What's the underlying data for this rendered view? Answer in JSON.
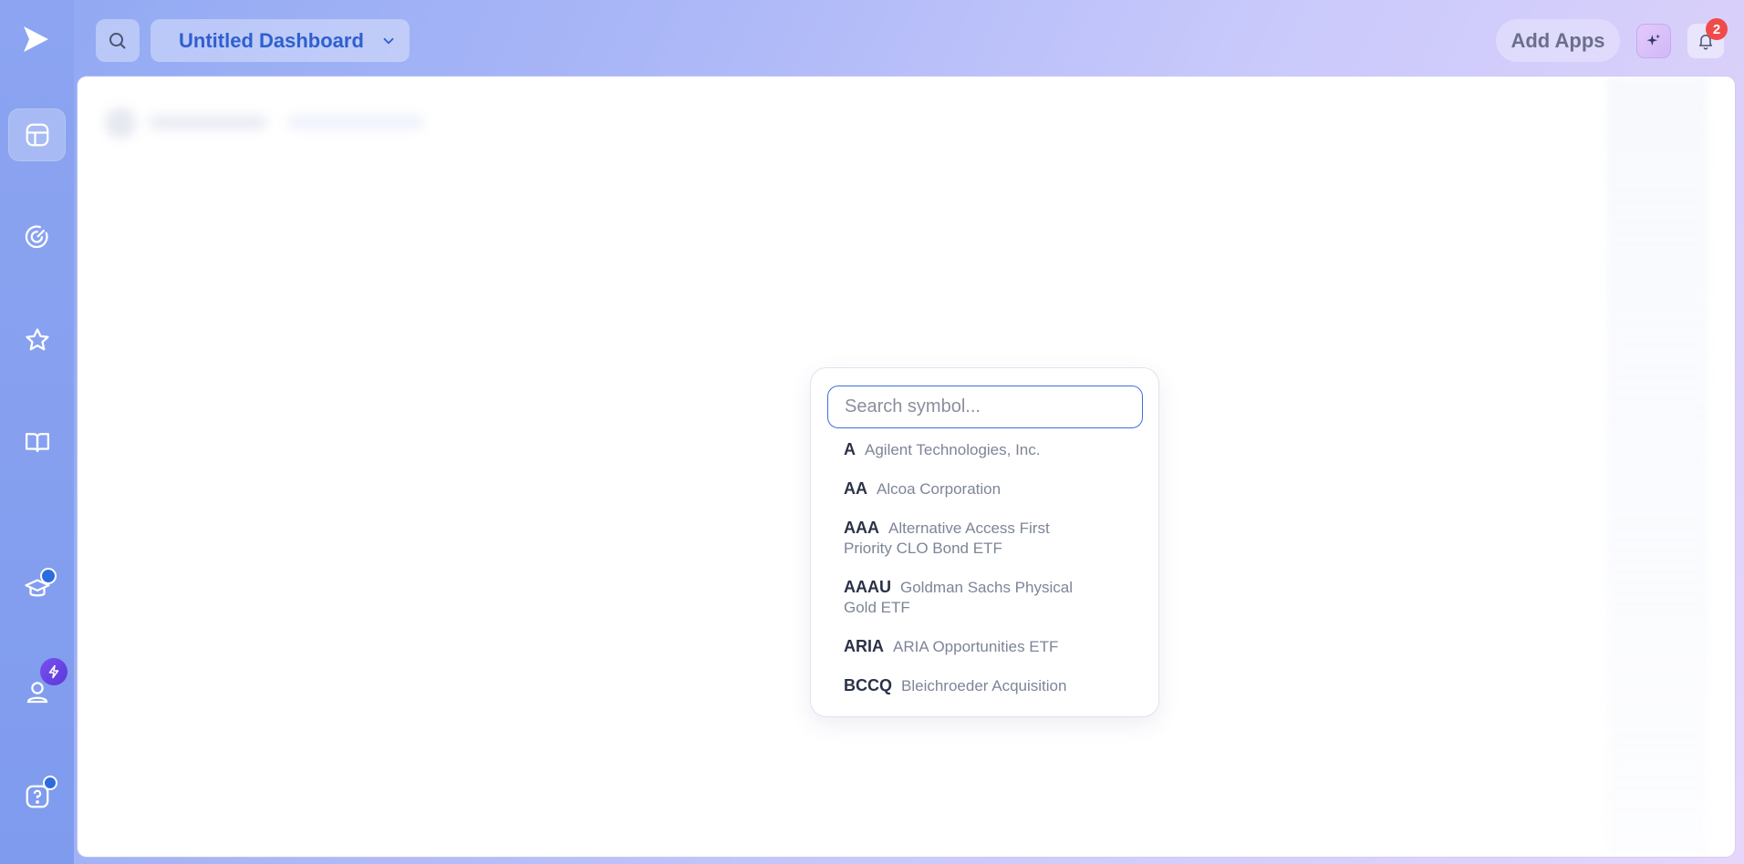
{
  "sidebar": {
    "logo_icon": "play-logo-icon",
    "items": [
      {
        "id": "dashboard",
        "icon": "dashboard-icon",
        "active": true
      },
      {
        "id": "activity",
        "icon": "radar-icon",
        "active": false
      },
      {
        "id": "favorites",
        "icon": "star-icon",
        "active": false
      },
      {
        "id": "learn",
        "icon": "book-icon",
        "active": false
      },
      {
        "id": "academy",
        "icon": "graduation-cap-icon",
        "active": false,
        "badge": "dot"
      },
      {
        "id": "profile",
        "icon": "user-icon",
        "active": false,
        "badge": "bolt"
      },
      {
        "id": "help",
        "icon": "help-icon",
        "active": false,
        "badge": "dot"
      }
    ]
  },
  "header": {
    "dashboard_title": "Untitled Dashboard",
    "add_apps_label": "Add Apps",
    "notification_count": "2"
  },
  "symbol_search": {
    "placeholder": "Search symbol...",
    "results": [
      {
        "ticker": "A",
        "name": "Agilent Technologies, Inc."
      },
      {
        "ticker": "AA",
        "name": "Alcoa Corporation"
      },
      {
        "ticker": "AAA",
        "name": "Alternative Access First Priority CLO Bond ETF"
      },
      {
        "ticker": "AAAU",
        "name": "Goldman Sachs Physical Gold ETF"
      },
      {
        "ticker": "ARIA",
        "name": "ARIA Opportunities ETF"
      },
      {
        "ticker": "BCCQ",
        "name": "Bleichroeder Acquisition"
      }
    ]
  },
  "colors": {
    "accent": "#2f5fd0",
    "input_border": "#3d6fd8",
    "badge_red": "#ef4b4b",
    "bolt_purple": "#6a45e6"
  }
}
